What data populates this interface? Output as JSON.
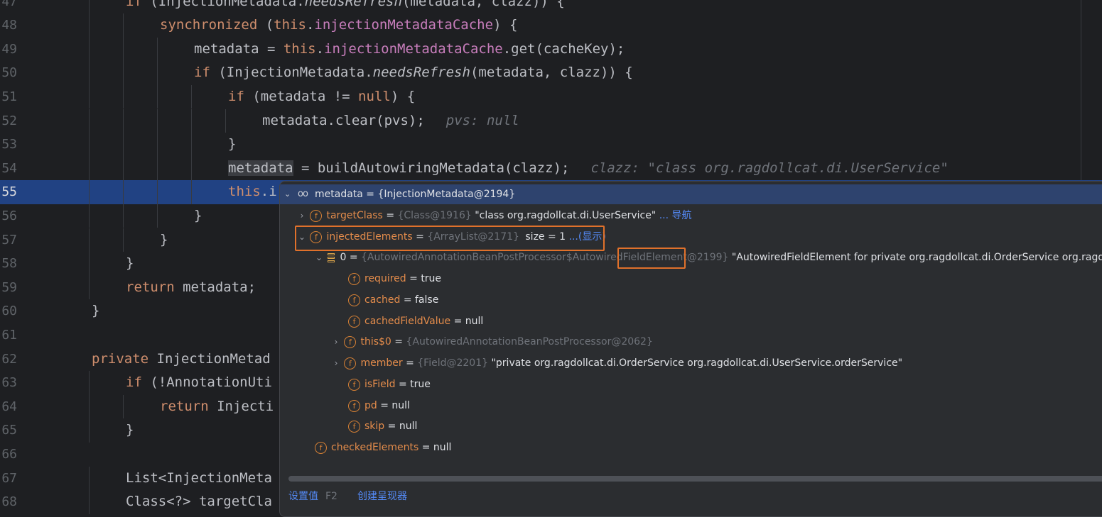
{
  "editor": {
    "lines": [
      {
        "num": "47",
        "parts": [
          {
            "t": "if ",
            "c": "kw"
          },
          {
            "t": "(InjectionMetadata."
          },
          {
            "t": "needsRefresh",
            "c": "it"
          },
          {
            "t": "(metadata, clazz)) {"
          }
        ]
      },
      {
        "num": "48",
        "parts": [
          {
            "t": "synchronized ",
            "c": "kw"
          },
          {
            "t": "("
          },
          {
            "t": "this",
            "c": "kw"
          },
          {
            "t": "."
          },
          {
            "t": "injectionMetadataCache",
            "c": "fld"
          },
          {
            "t": ") {"
          }
        ]
      },
      {
        "num": "49",
        "parts": [
          {
            "t": "metadata = "
          },
          {
            "t": "this",
            "c": "kw"
          },
          {
            "t": "."
          },
          {
            "t": "injectionMetadataCache",
            "c": "fld"
          },
          {
            "t": ".get(cacheKey);"
          }
        ]
      },
      {
        "num": "50",
        "parts": [
          {
            "t": "if ",
            "c": "kw"
          },
          {
            "t": "(InjectionMetadata."
          },
          {
            "t": "needsRefresh",
            "c": "it"
          },
          {
            "t": "(metadata, clazz)) {"
          }
        ]
      },
      {
        "num": "51",
        "parts": [
          {
            "t": "if ",
            "c": "kw"
          },
          {
            "t": "(metadata != "
          },
          {
            "t": "null",
            "c": "kw"
          },
          {
            "t": ") {"
          }
        ]
      },
      {
        "num": "52",
        "parts": [
          {
            "t": "metadata.clear(pvs);"
          },
          {
            "t": "pvs: null",
            "c": "inl"
          }
        ]
      },
      {
        "num": "53",
        "parts": [
          {
            "t": "}"
          }
        ]
      },
      {
        "num": "54",
        "parts": [
          {
            "t": "metadata",
            "c": "hl-word"
          },
          {
            "t": " = buildAutowiringMetadata(clazz);"
          },
          {
            "t": "clazz: \"class org.ragdollcat.di.UserService\"",
            "c": "inl"
          }
        ]
      },
      {
        "num": "55",
        "parts": [
          {
            "t": "this",
            "c": "kw"
          },
          {
            "t": ".i"
          }
        ]
      },
      {
        "num": "56",
        "parts": [
          {
            "t": "}"
          }
        ]
      },
      {
        "num": "57",
        "parts": [
          {
            "t": "}"
          }
        ]
      },
      {
        "num": "58",
        "parts": [
          {
            "t": "}"
          }
        ]
      },
      {
        "num": "59",
        "parts": [
          {
            "t": "return ",
            "c": "kw"
          },
          {
            "t": "metadata;"
          }
        ]
      },
      {
        "num": "60",
        "parts": [
          {
            "t": "}"
          }
        ]
      },
      {
        "num": "61",
        "parts": []
      },
      {
        "num": "62",
        "parts": [
          {
            "t": "private ",
            "c": "kw"
          },
          {
            "t": "InjectionMetad"
          }
        ]
      },
      {
        "num": "63",
        "parts": [
          {
            "t": "if ",
            "c": "kw"
          },
          {
            "t": "(!AnnotationUti"
          }
        ]
      },
      {
        "num": "64",
        "parts": [
          {
            "t": "return ",
            "c": "kw"
          },
          {
            "t": "Injecti"
          }
        ]
      },
      {
        "num": "65",
        "parts": [
          {
            "t": "}"
          }
        ]
      },
      {
        "num": "66",
        "parts": []
      },
      {
        "num": "67",
        "parts": [
          {
            "t": "List<InjectionMeta"
          }
        ]
      },
      {
        "num": "68",
        "parts": [
          {
            "t": "Class<?> targetCla"
          }
        ]
      }
    ]
  },
  "popup": {
    "header": "metadata = {InjectionMetadata@2194}",
    "rows": [
      {
        "name": "targetClass",
        "ref": "{Class@1916}",
        "value": "\"class org.ragdollcat.di.UserService\"",
        "link": "... 导航"
      },
      {
        "name": "injectedElements",
        "ref": "{ArrayList@2171}",
        "value": "size = 1",
        "link": "...(显示)"
      },
      {
        "name": "0",
        "ref_a": "{AutowiredAnnotationBeanPostProcessor$Autowired",
        "ref_b": "FieldElement",
        "ref_c": "@2199}",
        "value": "\"AutowiredFieldElement for private org.ragdollcat.di.OrderService org.ragdollcat"
      },
      {
        "name": "required",
        "value": "true"
      },
      {
        "name": "cached",
        "value": "false"
      },
      {
        "name": "cachedFieldValue",
        "value": "null"
      },
      {
        "name": "this$0",
        "ref": "{AutowiredAnnotationBeanPostProcessor@2062}",
        "value": ""
      },
      {
        "name": "member",
        "ref": "{Field@2201}",
        "value": "\"private org.ragdollcat.di.OrderService org.ragdollcat.di.UserService.orderService\""
      },
      {
        "name": "isField",
        "value": "true"
      },
      {
        "name": "pd",
        "value": "null"
      },
      {
        "name": "skip",
        "value": "null"
      },
      {
        "name": "checkedElements",
        "value": "null"
      }
    ],
    "footer": {
      "set_value": "设置值",
      "set_value_key": "F2",
      "create_renderer": "创建呈现器"
    }
  },
  "colors": {
    "background": "#1e1f22",
    "current_line": "#214283",
    "keyword": "#cf8e6d",
    "field": "#c77dbb",
    "orange_box": "#e0712b",
    "link": "#548af7"
  },
  "icons": [
    "glasses-icon",
    "field-icon",
    "array-icon",
    "chevron-right-icon",
    "chevron-down-icon"
  ]
}
